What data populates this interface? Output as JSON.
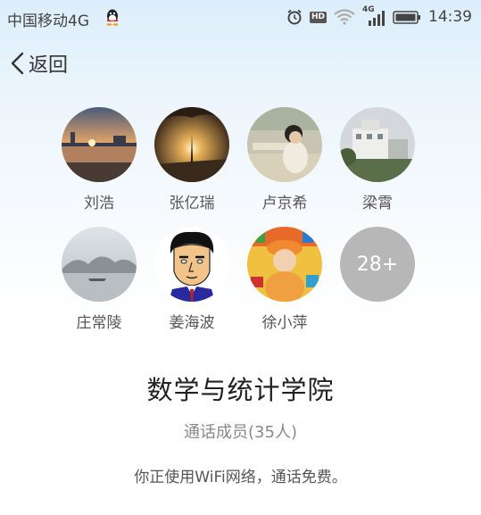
{
  "status_bar": {
    "carrier": "中国移动4G",
    "hd_badge": "HD",
    "network": "4G",
    "time": "14:39"
  },
  "header": {
    "back_label": "返回"
  },
  "members": [
    {
      "name": "刘浩",
      "avatar": "sunset-lake-photo"
    },
    {
      "name": "张亿瑞",
      "avatar": "sunset-tree-photo"
    },
    {
      "name": "卢京希",
      "avatar": "girl-at-desk-photo"
    },
    {
      "name": "梁霄",
      "avatar": "building-photo"
    },
    {
      "name": "庄常陵",
      "avatar": "misty-landscape-photo"
    },
    {
      "name": "姜海波",
      "avatar": "cartoon-man-portrait"
    },
    {
      "name": "徐小萍",
      "avatar": "child-with-toys-photo"
    }
  ],
  "more_members": "28+",
  "group": {
    "title": "数学与统计学院",
    "member_count": "通话成员(35人)",
    "notice": "你正使用WiFi网络，通话免费。"
  },
  "colors": {
    "background_top": "#dceefb",
    "more_circle": "#b7b7b7",
    "title_text": "#222222",
    "muted_text": "#888888"
  }
}
